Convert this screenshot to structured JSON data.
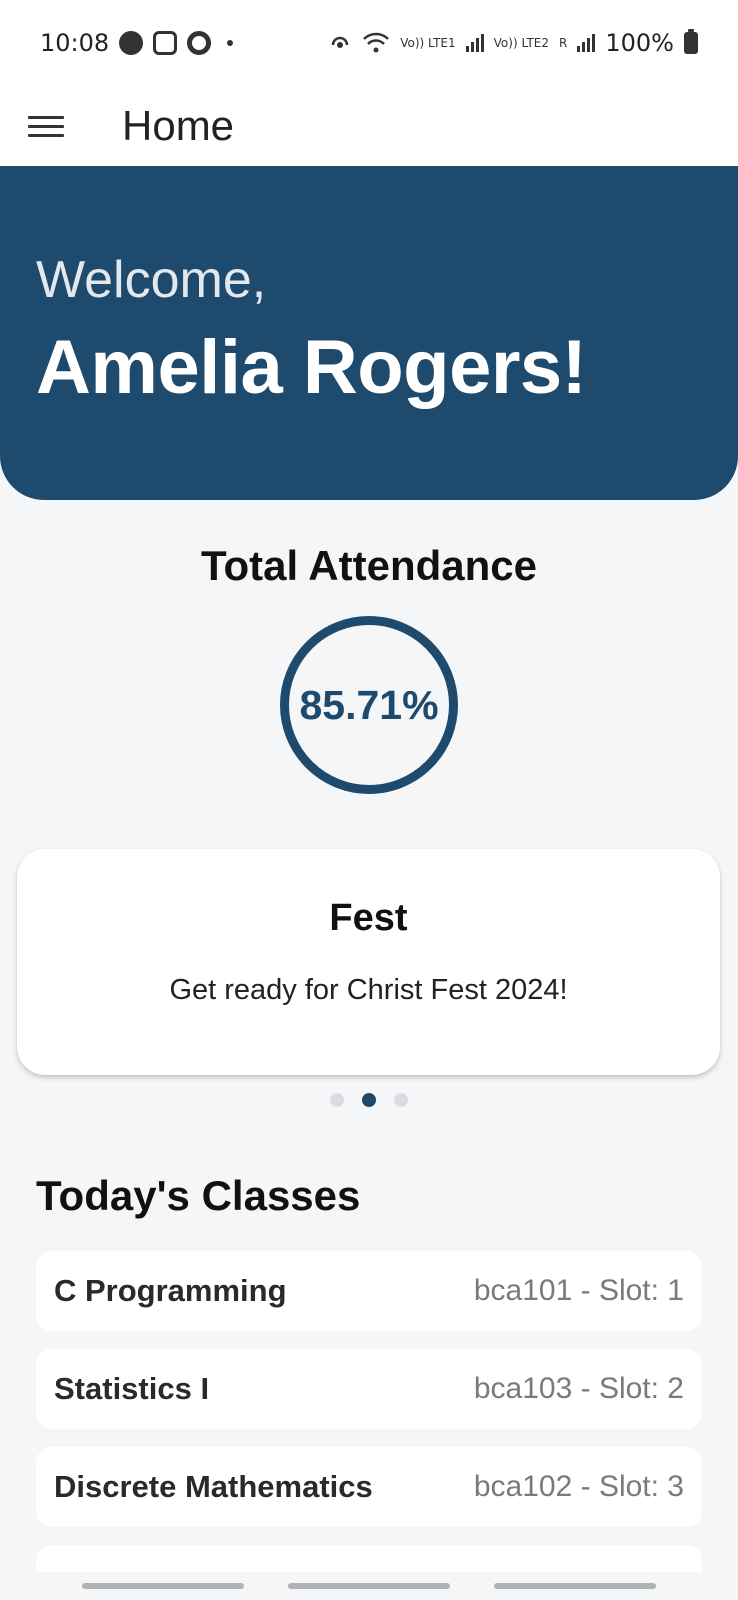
{
  "status_bar": {
    "time": "10:08",
    "lte1": "Vo)) LTE1",
    "lte2": "Vo)) LTE2",
    "roaming": "R",
    "battery": "100%",
    "icons": [
      "app-icon",
      "instagram-icon",
      "ring-app-icon",
      "hotspot-icon",
      "wifi-icon",
      "signal-icon",
      "battery-icon"
    ]
  },
  "app_bar": {
    "title": "Home",
    "menu_icon": "hamburger-menu-icon"
  },
  "banner": {
    "greeting": "Welcome,",
    "name": "Amelia Rogers!",
    "color": "#1e4a6d"
  },
  "attendance": {
    "title": "Total Attendance",
    "value": "85.71%",
    "percent": 85.71
  },
  "carousel": {
    "title": "Fest",
    "body": "Get ready for Christ Fest 2024!",
    "active_index": 1,
    "count": 3
  },
  "classes": {
    "title": "Today's Classes",
    "items": [
      {
        "name": "C Programming",
        "meta": "bca101 - Slot: 1"
      },
      {
        "name": "Statistics I",
        "meta": "bca103 - Slot: 2"
      },
      {
        "name": "Discrete Mathematics",
        "meta": "bca102 - Slot: 3"
      }
    ]
  },
  "colors": {
    "accent": "#1e4a6d",
    "background": "#f5f6f8",
    "card": "#ffffff"
  }
}
